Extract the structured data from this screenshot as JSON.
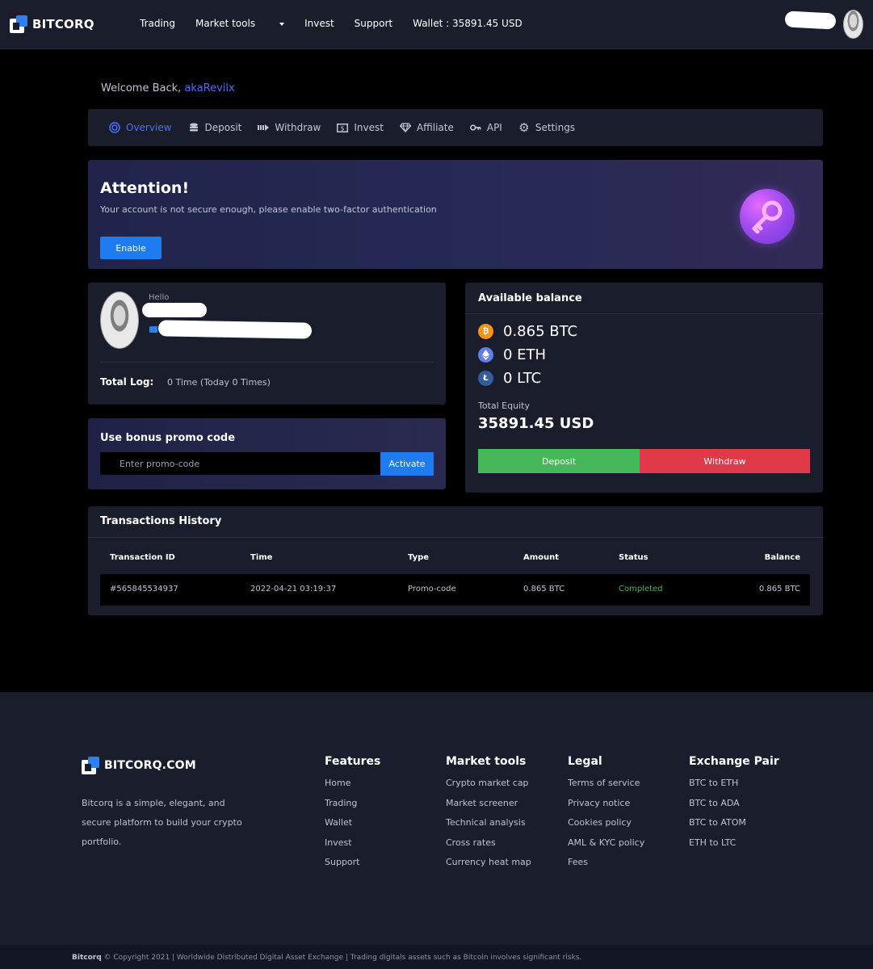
{
  "header": {
    "logo": "BITCORQ",
    "nav": {
      "trading": "Trading",
      "market_tools": "Market tools",
      "invest": "Invest",
      "support": "Support",
      "wallet": "Wallet : 35891.45 USD"
    }
  },
  "welcome": {
    "prefix": "Welcome Back,",
    "username": "akaRevilx"
  },
  "tabs": [
    "Overview",
    "Deposit",
    "Withdraw",
    "Invest",
    "Affiliate",
    "API",
    "Settings"
  ],
  "attention": {
    "title": "Attention!",
    "text": "Your account is not secure enough, please enable two-factor authentication",
    "button": "Enable"
  },
  "profile": {
    "hello": "Hello",
    "total_log_label": "Total Log:",
    "total_log_value": "0 Time (Today 0 Times)"
  },
  "promo": {
    "title": "Use bonus promo code",
    "placeholder": "Enter promo-code",
    "button": "Activate"
  },
  "balance": {
    "title": "Available balance",
    "coins": [
      "0.865 BTC",
      "0 ETH",
      "0 LTC"
    ],
    "equity_label": "Total Equity",
    "equity_value": "35891.45 USD",
    "deposit_button": "Deposit",
    "withdraw_button": "Withdraw"
  },
  "transactions": {
    "title": "Transactions History",
    "columns": [
      "Transaction ID",
      "Time",
      "Type",
      "Amount",
      "Status",
      "Balance"
    ],
    "rows": [
      [
        "#565845534937",
        "2022-04-21 03:19:37",
        "Promo-code",
        "0.865 BTC",
        "Completed",
        "0.865 BTC"
      ]
    ]
  },
  "footer": {
    "logo": "BITCORQ.COM",
    "description": "Bitcorq is a simple, elegant, and secure platform to build your crypto portfolio.",
    "columns": [
      {
        "title": "Features",
        "items": [
          "Home",
          "Trading",
          "Wallet",
          "Invest",
          "Support"
        ]
      },
      {
        "title": "Market tools",
        "items": [
          "Crypto market cap",
          "Market screener",
          "Technical analysis",
          "Cross rates",
          "Currency heat map"
        ]
      },
      {
        "title": "Legal",
        "items": [
          "Terms of service",
          "Privacy notice",
          "Cookies policy",
          "AML & KYC policy",
          "Fees"
        ]
      },
      {
        "title": "Exchange Pair",
        "items": [
          "BTC to ETH",
          "BTC to ADA",
          "BTC to ATOM",
          "ETH to LTC"
        ]
      }
    ],
    "copyright_brand": "Bitcorq",
    "copyright_text": "© Copyright 2021 | Worldwide Distributed Digital Asset Exchange | Trading digitals assets such as Bitcoin involves significant risks."
  },
  "colors": {
    "accent": "#4f6ef7",
    "primary_button": "#1e7bf0",
    "success": "#45b95a",
    "danger": "#e03a48",
    "panel": "#1a1d2b",
    "btc": "#f7931a",
    "eth": "#627eea",
    "ltc": "#345d9d"
  }
}
